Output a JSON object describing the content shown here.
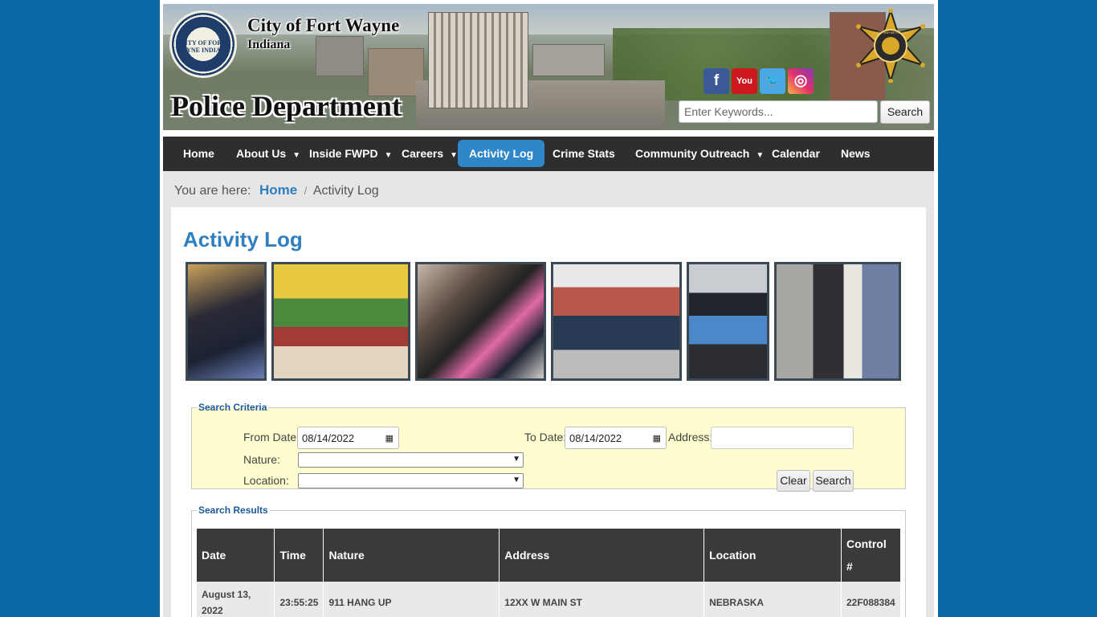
{
  "header": {
    "city_name": "City of Fort Wayne",
    "state_name": "Indiana",
    "department_name": "Police Department",
    "seal_text": "CITY OF FORT WAYNE INDIANA",
    "badge_text": "FORT WAYNE POLICE",
    "social": [
      {
        "name": "facebook",
        "glyph": "f"
      },
      {
        "name": "youtube",
        "glyph": "You"
      },
      {
        "name": "twitter",
        "glyph": "🐦"
      },
      {
        "name": "instagram",
        "glyph": "◎"
      }
    ],
    "search_placeholder": "Enter Keywords...",
    "search_button": "Search"
  },
  "nav": {
    "items": [
      {
        "label": "Home",
        "dropdown": false
      },
      {
        "label": "About Us",
        "dropdown": true
      },
      {
        "label": "Inside FWPD",
        "dropdown": true
      },
      {
        "label": "Careers",
        "dropdown": true
      },
      {
        "label": "Activity Log",
        "dropdown": false,
        "active": true
      },
      {
        "label": "Crime Stats",
        "dropdown": false
      },
      {
        "label": "Community Outreach",
        "dropdown": true
      },
      {
        "label": "Calendar",
        "dropdown": false
      },
      {
        "label": "News",
        "dropdown": false
      }
    ],
    "caret": "▼"
  },
  "breadcrumb": {
    "prefix": "You are here:",
    "home": "Home",
    "separator": "/",
    "current": "Activity Log"
  },
  "page_title": "Activity Log",
  "search_criteria": {
    "legend": "Search Criteria",
    "from_date_label": "From Date:",
    "from_date_value": "08/14/2022",
    "to_date_label": "To Date:",
    "to_date_value": "08/14/2022",
    "address_label": "Address:",
    "address_value": "",
    "nature_label": "Nature:",
    "nature_value": "",
    "location_label": "Location:",
    "location_value": "",
    "clear_button": "Clear",
    "search_button": "Search"
  },
  "search_results": {
    "legend": "Search Results",
    "columns": [
      "Date",
      "Time",
      "Nature",
      "Address",
      "Location",
      "Control #"
    ],
    "rows": [
      {
        "date": "August 13, 2022",
        "time": "23:55:25",
        "nature": "911 HANG UP",
        "address": "12XX W MAIN ST",
        "location": "NEBRASKA",
        "control": "22F088384"
      }
    ]
  },
  "colors": {
    "background": "#0a68a6",
    "nav_bg": "#2e2e2e",
    "nav_active": "#2f87c9",
    "title": "#2f7fc1",
    "criteria_bg": "#fefdd0",
    "table_header": "#3a3a3a"
  }
}
